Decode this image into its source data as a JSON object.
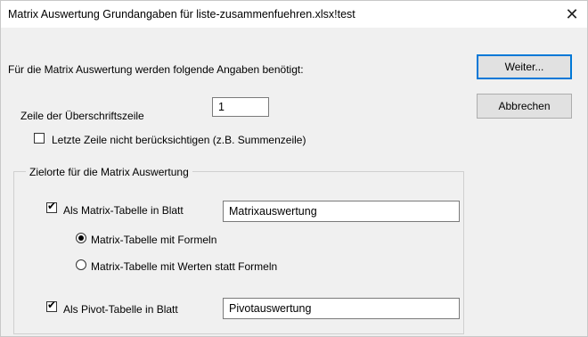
{
  "window": {
    "title": "Matrix Auswertung Grundangaben für liste-zusammenfuehren.xlsx!test",
    "close_symbol": "✕"
  },
  "intro_text": "Für die Matrix Auswertung werden folgende Angaben benötigt:",
  "header_row": {
    "label": "Zeile der Überschriftszeile",
    "value": "1"
  },
  "ignore_last_row": {
    "label": "Letzte Zeile nicht berücksichtigen (z.B. Summenzeile)",
    "checked": false
  },
  "buttons": {
    "next": "Weiter...",
    "cancel": "Abbrechen"
  },
  "targets_group": {
    "legend": "Zielorte für die Matrix Auswertung",
    "matrix_table": {
      "label": "Als Matrix-Tabelle in Blatt",
      "checked": true,
      "sheet_value": "Matrixauswertung"
    },
    "radio_formulas": {
      "label": "Matrix-Tabelle mit Formeln",
      "selected": true
    },
    "radio_values": {
      "label": "Matrix-Tabelle mit Werten statt Formeln",
      "selected": false
    },
    "pivot_table": {
      "label": "Als Pivot-Tabelle in Blatt",
      "checked": true,
      "sheet_value": "Pivotauswertung"
    }
  },
  "icons": {
    "checkmark": "✔",
    "close": "close-icon",
    "checkbox": "checkbox-icon",
    "radio": "radio-icon"
  },
  "colors": {
    "dialog_bg": "#f0f0f0",
    "title_bg": "#ffffff",
    "default_button_border": "#0078d7"
  }
}
